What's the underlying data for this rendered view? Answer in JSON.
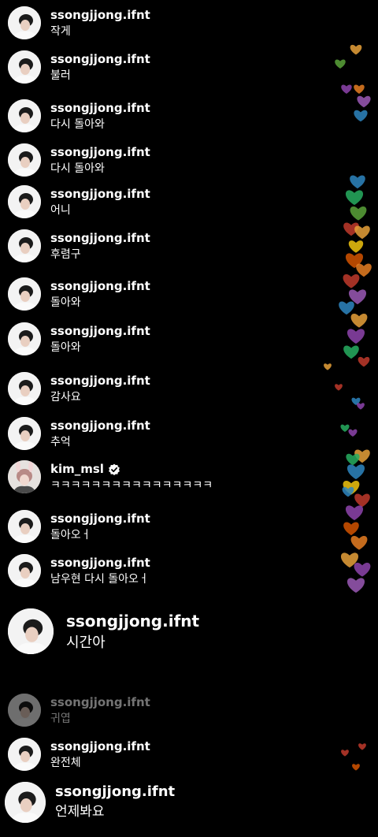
{
  "comments": [
    {
      "user": "ssongjjong.ifnt",
      "text": "작게"
    },
    {
      "user": "ssongjjong.ifnt",
      "text": "불러"
    },
    {
      "user": "ssongjjong.ifnt",
      "text": "다시 돌아와"
    },
    {
      "user": "ssongjjong.ifnt",
      "text": "다시 돌아와"
    },
    {
      "user": "ssongjjong.ifnt",
      "text": "어니"
    },
    {
      "user": "ssongjjong.ifnt",
      "text": "후렴구"
    },
    {
      "user": "ssongjjong.ifnt",
      "text": "돌아와"
    },
    {
      "user": "ssongjjong.ifnt",
      "text": "돌아와"
    },
    {
      "user": "ssongjjong.ifnt",
      "text": "감사요"
    },
    {
      "user": "ssongjjong.ifnt",
      "text": "추억"
    },
    {
      "user": "kim_msl",
      "text": "ㅋㅋㅋㅋㅋㅋㅋㅋㅋㅋㅋㅋㅋㅋㅋㅋ",
      "verified": true
    },
    {
      "user": "ssongjjong.ifnt",
      "text": "돌아오ㅓ"
    },
    {
      "user": "ssongjjong.ifnt",
      "text": "남우현 다시 돌아오ㅓ"
    },
    {
      "user": "ssongjjong.ifnt",
      "text": "시간아"
    },
    {
      "user": "ssongjjong.ifnt",
      "text": "귀엽"
    },
    {
      "user": "ssongjjong.ifnt",
      "text": "완전체"
    },
    {
      "user": "ssongjjong.ifnt",
      "text": "언제봐요"
    }
  ],
  "heart_colors": [
    "#e8a13a",
    "#5aa33a",
    "#c0392b",
    "#8e44ad",
    "#2e86c1",
    "#e67e22",
    "#d35400",
    "#27ae60",
    "#f1c40f",
    "#9b59b6"
  ]
}
